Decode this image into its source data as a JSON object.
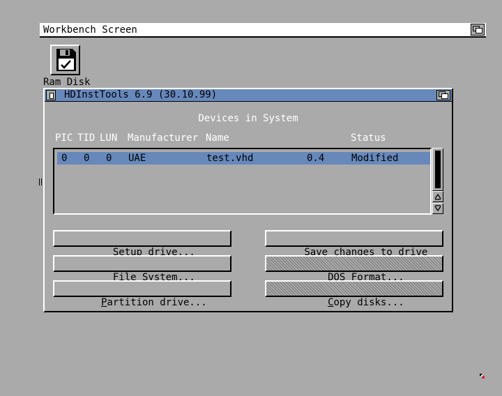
{
  "screen": {
    "title": "Workbench Screen",
    "icons": [
      {
        "name": "ram-disk",
        "label": "Ram Disk"
      }
    ]
  },
  "window": {
    "title": "HDInstTools 6.9 (30.10.99)",
    "section_heading": "Devices in System",
    "columns": [
      "PIC",
      "TID",
      "LUN",
      "Manufacturer",
      "Name",
      "Status"
    ],
    "devices": [
      {
        "pic": "0",
        "tid": "0",
        "lun": "0",
        "manufacturer": "UAE",
        "name": "test.vhd",
        "revision": "0.4",
        "status": "Modified"
      }
    ],
    "buttons": {
      "setup_drive": {
        "label": "Setup drive...",
        "accel": "S",
        "rest": "etup drive...",
        "enabled": true
      },
      "file_system": {
        "label": "File System...",
        "accel": "F",
        "rest": "ile System...",
        "enabled": true
      },
      "partition_drive": {
        "label": "Partition drive...",
        "accel": "P",
        "rest": "artition drive...",
        "enabled": true
      },
      "save_changes": {
        "label": "Save changes to drive",
        "accel": "S",
        "rest": "ave changes to drive",
        "enabled": true
      },
      "dos_format": {
        "label": "DOS Format...",
        "accel": "D",
        "rest": "OS Format...",
        "enabled": false
      },
      "copy_disks": {
        "label": "Copy disks...",
        "accel": "C",
        "rest": "opy disks...",
        "enabled": false
      }
    }
  },
  "colors": {
    "background": "#aaaaaa",
    "highlight": "#6688bb",
    "shine": "#ffffff",
    "shadow": "#000000"
  }
}
